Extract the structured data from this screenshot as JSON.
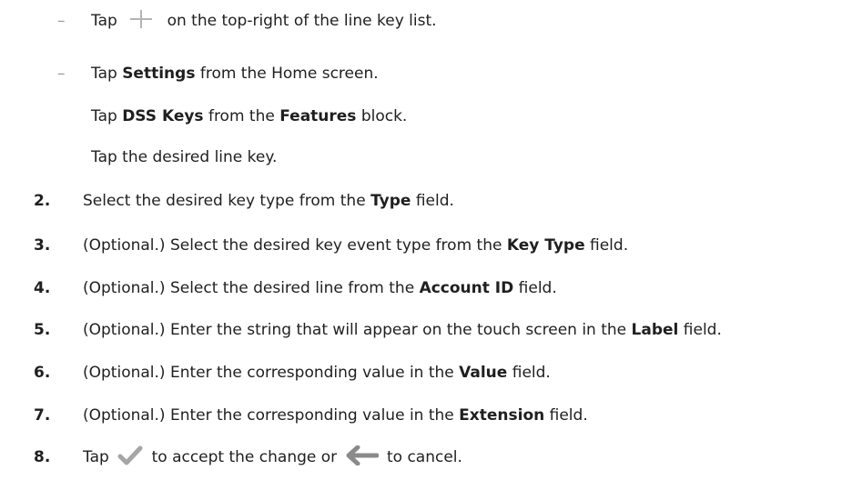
{
  "bullets": [
    {
      "dash": "–",
      "before": "Tap",
      "icon": "add-icon",
      "after": "on the top-right of the line key list."
    },
    {
      "dash": "–",
      "before": "Tap",
      "bold1": "Settings",
      "after": "from the Home screen."
    }
  ],
  "sub_lines": [
    {
      "before": "Tap",
      "bold1": "DSS Keys",
      "mid": "from the",
      "bold2": "Features",
      "after": "block."
    },
    {
      "text": "Tap the desired line key."
    }
  ],
  "steps": [
    {
      "num": "2.",
      "before": "Select the desired key type from the",
      "bold": "Type",
      "after": "field."
    },
    {
      "num": "3.",
      "before": "(Optional.) Select the desired key event type from the",
      "bold": "Key Type",
      "after": "field."
    },
    {
      "num": "4.",
      "before": "(Optional.) Select the desired line from the",
      "bold": "Account ID",
      "after": "field."
    },
    {
      "num": "5.",
      "before": "(Optional.) Enter the string that will appear on the touch screen in the",
      "bold": "Label",
      "after": "field."
    },
    {
      "num": "6.",
      "before": "(Optional.) Enter the corresponding value in the",
      "bold": "Value",
      "after": "field."
    },
    {
      "num": "7.",
      "before": "(Optional.) Enter the corresponding value in the",
      "bold": "Extension",
      "after": "field."
    },
    {
      "num": "8.",
      "before": "Tap",
      "icon1": "check-icon",
      "mid": "to accept the change or",
      "icon2": "back-arrow-icon",
      "after": "to cancel."
    }
  ],
  "colors": {
    "text": "#1f1f1f",
    "dash": "#9a9a9a",
    "icon_gray": "#b4b4b4",
    "check": "#a6a6a6",
    "arrow": "#8a8a8a"
  }
}
